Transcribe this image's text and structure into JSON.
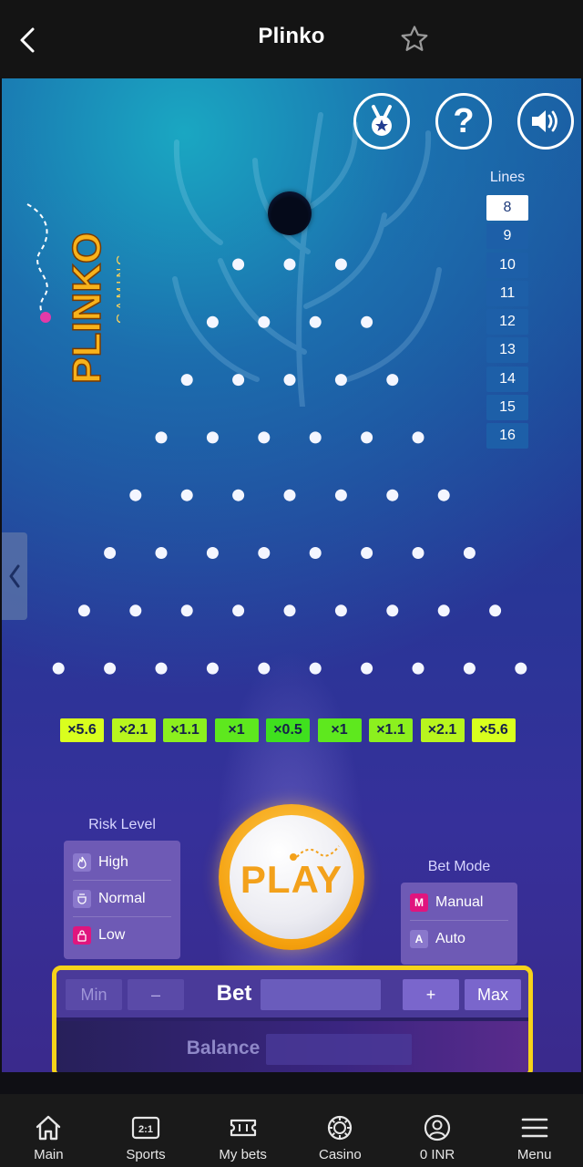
{
  "topbar": {
    "title": "Plinko"
  },
  "lines": {
    "label": "Lines",
    "options": [
      "8",
      "9",
      "10",
      "11",
      "12",
      "13",
      "14",
      "15",
      "16"
    ],
    "selected": "8"
  },
  "multipliers": [
    {
      "label": "×5.6",
      "color": "#d9ff1e"
    },
    {
      "label": "×2.1",
      "color": "#b8f51e"
    },
    {
      "label": "×1.1",
      "color": "#8cf01e"
    },
    {
      "label": "×1",
      "color": "#5ee81e"
    },
    {
      "label": "×0.5",
      "color": "#3fe01e"
    },
    {
      "label": "×1",
      "color": "#5ee81e"
    },
    {
      "label": "×1.1",
      "color": "#8cf01e"
    },
    {
      "label": "×2.1",
      "color": "#b8f51e"
    },
    {
      "label": "×5.6",
      "color": "#d9ff1e"
    }
  ],
  "risk": {
    "label": "Risk Level",
    "options": [
      "High",
      "Normal",
      "Low"
    ]
  },
  "bet_mode": {
    "label": "Bet Mode",
    "options": [
      {
        "key": "M",
        "label": "Manual"
      },
      {
        "key": "A",
        "label": "Auto"
      }
    ]
  },
  "play": {
    "label": "PLAY"
  },
  "bet": {
    "min_label": "Min",
    "minus_label": "–",
    "bet_label": "Bet",
    "plus_label": "+",
    "max_label": "Max",
    "balance_label": "Balance"
  },
  "nav": {
    "items": [
      {
        "label": "Main",
        "icon": "home-icon"
      },
      {
        "label": "Sports",
        "icon": "sports-odds-icon"
      },
      {
        "label": "My bets",
        "icon": "ticket-icon"
      },
      {
        "label": "Casino",
        "icon": "casino-chip-icon"
      },
      {
        "label": "0 INR",
        "icon": "user-circle-icon"
      },
      {
        "label": "Menu",
        "icon": "menu-icon"
      }
    ]
  },
  "colors": {
    "accent_highlight": "#f6d31a",
    "play_orange": "#f5a10f",
    "panel_purple": "#6e5ab5"
  }
}
